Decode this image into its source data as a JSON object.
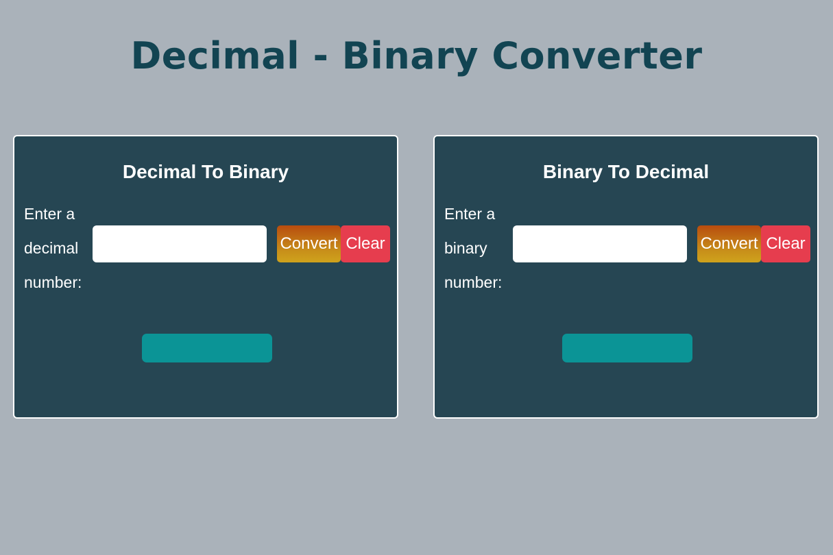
{
  "page": {
    "title": "Decimal - Binary Converter"
  },
  "colors": {
    "background": "#aab2ba",
    "title": "#124452",
    "card": "#264653",
    "convert_gradient": [
      "#b84c0e",
      "#cfa31c"
    ],
    "clear": "#e63d4e",
    "result": "#0b9496"
  },
  "dec_to_bin": {
    "title": "Decimal To Binary",
    "prompt_line1": "Enter a",
    "prompt_line2": "decimal",
    "prompt_line3": "number:",
    "input_value": "",
    "convert_label": "Convert",
    "clear_label": "Clear",
    "result": ""
  },
  "bin_to_dec": {
    "title": "Binary To Decimal",
    "prompt_line1": "Enter a",
    "prompt_line2": "binary",
    "prompt_line3": "number:",
    "input_value": "",
    "convert_label": "Convert",
    "clear_label": "Clear",
    "result": ""
  }
}
